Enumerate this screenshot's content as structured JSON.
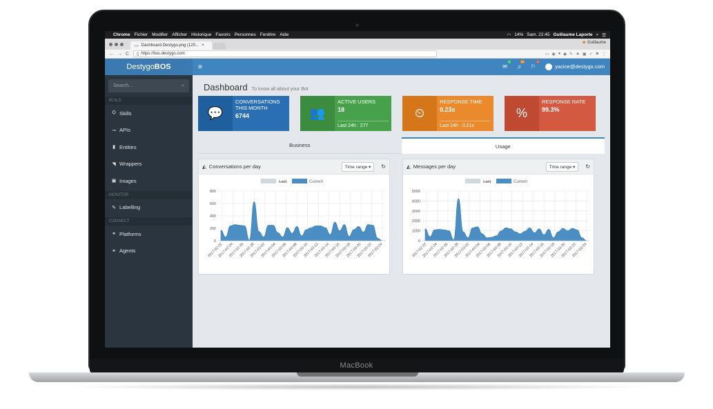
{
  "device_label": "MacBook",
  "menubar": {
    "apple": "",
    "items": [
      "Chrome",
      "Fichier",
      "Modifier",
      "Afficher",
      "Historique",
      "Favoris",
      "Personnes",
      "Fenêtre",
      "Aide"
    ],
    "battery": "14%",
    "clock": "Sam. 22:45",
    "user": "Guillaume Laporte"
  },
  "browser": {
    "tab_title": "Dashboard Destygo.png (120...",
    "profile": "Guillaume",
    "url": "https://bos.destygo.com"
  },
  "sidebar": {
    "brand_light": "Destygo",
    "brand_bold": "BOS",
    "search_placeholder": "Search...",
    "sections": {
      "build": "BUILD",
      "monitor": "MONITOR",
      "connect": "CONNECT"
    },
    "build_items": [
      {
        "label": "Skills",
        "icon": "skills-icon"
      },
      {
        "label": "APIs",
        "icon": "api-icon"
      },
      {
        "label": "Entities",
        "icon": "book-icon"
      },
      {
        "label": "Wrappers",
        "icon": "tag-icon"
      },
      {
        "label": "Images",
        "icon": "image-icon"
      }
    ],
    "monitor_items": [
      {
        "label": "Labelling",
        "icon": "pencil-icon"
      }
    ],
    "connect_items": [
      {
        "label": "Platforms",
        "icon": "link-icon"
      },
      {
        "label": "Agents",
        "icon": "link-icon"
      }
    ]
  },
  "topbar": {
    "badges": {
      "messages": "1",
      "notifications": "10",
      "flags": "3"
    },
    "user_email": "yacine@destygo.com"
  },
  "page": {
    "title": "Dashboard",
    "subtitle": "To know all about your Bot"
  },
  "stats": [
    {
      "label": "Conversations this month",
      "value": "6744",
      "sub": "",
      "color": "#2a6fb4",
      "icon_color": "#1f5f9e"
    },
    {
      "label": "Active users",
      "value": "18",
      "sub": "Last 24h : 277",
      "color": "#46a14a",
      "icon_color": "#3b8c3f"
    },
    {
      "label": "Response time",
      "value": "0.23s",
      "sub": "Last 24h : 0.21s",
      "color": "#eb8a2d",
      "icon_color": "#d6761b"
    },
    {
      "label": "Response rate",
      "value": "99.3%",
      "sub": "",
      "color": "#d35a40",
      "icon_color": "#bf4a31"
    }
  ],
  "tabs": {
    "business": "Business",
    "usage": "Usage"
  },
  "charts_ui": {
    "time_range": "Time range ▾",
    "legend_last": "Last",
    "legend_current": "Current"
  },
  "chart_data": [
    {
      "type": "area",
      "title": "Conversations per day",
      "legend": [
        "Last",
        "Current"
      ],
      "ylim": [
        0,
        800
      ],
      "yticks": [
        0,
        200,
        400,
        600,
        800
      ],
      "xticks": [
        "2017-02-22",
        "2017-02-24",
        "2017-02-26",
        "2017-02-28",
        "2017-03-02",
        "2017-03-04",
        "2017-03-06",
        "2017-03-08",
        "2017-03-10",
        "2017-03-12",
        "2017-03-14",
        "2017-03-16",
        "2017-03-18",
        "2017-03-20",
        "2017-03-22",
        "2017-03-24"
      ],
      "series": [
        {
          "name": "Current",
          "color": "#4a8ec4",
          "values": [
            170,
            60,
            240,
            260,
            250,
            240,
            10,
            630,
            150,
            60,
            250,
            250,
            130,
            60,
            210,
            120,
            230,
            80,
            180,
            210,
            240,
            240,
            210,
            100,
            300,
            160,
            260,
            70,
            180,
            230,
            140,
            260,
            250,
            40,
            0
          ]
        }
      ]
    },
    {
      "type": "area",
      "title": "Messages per day",
      "legend": [
        "Last",
        "Current"
      ],
      "ylim": [
        0,
        5000
      ],
      "yticks": [
        0,
        1000,
        2000,
        3000,
        4000,
        5000
      ],
      "xticks": [
        "2017-02-22",
        "2017-02-24",
        "2017-02-26",
        "2017-02-28",
        "2017-03-02",
        "2017-03-04",
        "2017-03-06",
        "2017-03-08",
        "2017-03-10",
        "2017-03-12",
        "2017-03-14",
        "2017-03-16",
        "2017-03-18",
        "2017-03-20",
        "2017-03-22",
        "2017-03-24"
      ],
      "series": [
        {
          "name": "Current",
          "color": "#4a8ec4",
          "values": [
            1200,
            400,
            1100,
            1150,
            1100,
            1000,
            100,
            4250,
            900,
            300,
            1300,
            1400,
            700,
            300,
            350,
            500,
            1000,
            1300,
            1200,
            900,
            700,
            950,
            1300,
            800,
            1200,
            600,
            1150,
            300,
            900,
            1250,
            1000,
            1250,
            1100,
            300,
            0
          ]
        }
      ]
    }
  ]
}
